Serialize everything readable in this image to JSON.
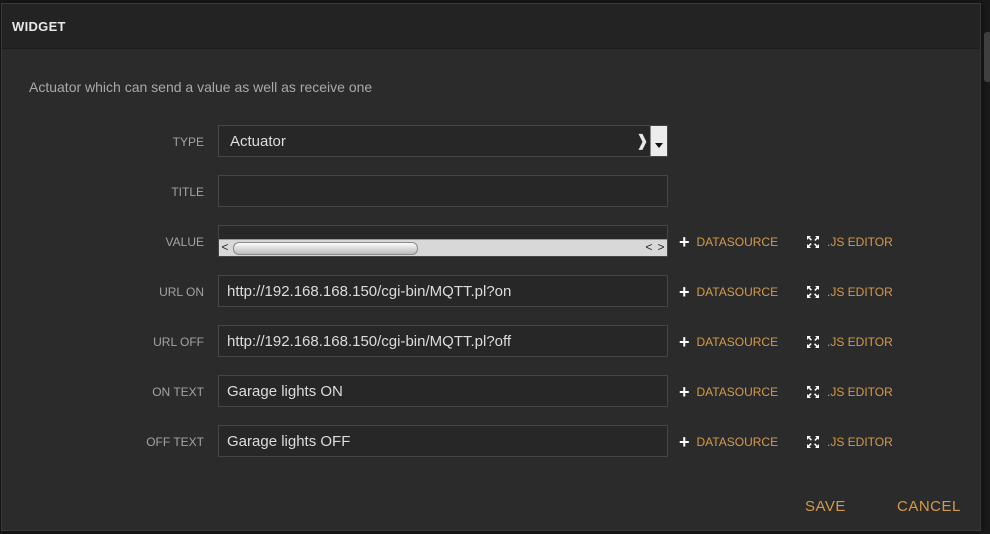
{
  "dialog": {
    "title": "WIDGET",
    "description": "Actuator which can send a value as well as receive one"
  },
  "fields": [
    {
      "label": "TYPE",
      "value": "Actuator"
    },
    {
      "label": "TITLE",
      "value": ""
    },
    {
      "label": "VALUE",
      "value": ""
    },
    {
      "label": "URL ON",
      "value": "http://192.168.168.150/cgi-bin/MQTT.pl?on"
    },
    {
      "label": "URL OFF",
      "value": "http://192.168.168.150/cgi-bin/MQTT.pl?off"
    },
    {
      "label": "ON TEXT",
      "value": "Garage lights ON"
    },
    {
      "label": "OFF TEXT",
      "value": "Garage lights OFF"
    }
  ],
  "actions": {
    "datasource_label": "DATASOURCE",
    "js_editor_label": ".JS EDITOR"
  },
  "footer": {
    "save_label": "SAVE",
    "cancel_label": "CANCEL"
  },
  "icons": {
    "datasource": "plus-icon",
    "js_editor": "expand-icon"
  },
  "colors": {
    "accent": "#d49a4a",
    "background": "#2b2b2b"
  }
}
